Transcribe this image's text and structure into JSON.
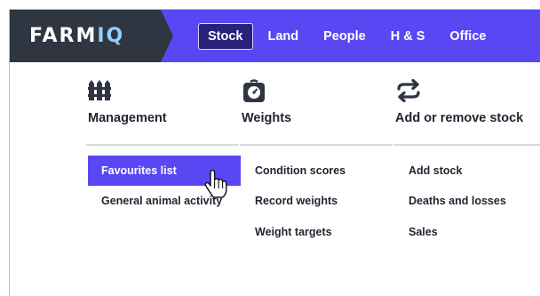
{
  "brand": {
    "logo_main": "FARM",
    "logo_accent": "IQ"
  },
  "nav": {
    "items": [
      {
        "label": "Stock",
        "active": true
      },
      {
        "label": "Land",
        "active": false
      },
      {
        "label": "People",
        "active": false
      },
      {
        "label": "H & S",
        "active": false
      },
      {
        "label": "Office",
        "active": false
      }
    ]
  },
  "menu": {
    "columns": [
      {
        "heading": "Management",
        "icon": "fence-icon",
        "links": [
          "Favourites list",
          "General animal activity"
        ],
        "selected_index": 0
      },
      {
        "heading": "Weights",
        "icon": "scale-icon",
        "links": [
          "Condition scores",
          "Record weights",
          "Weight targets"
        ]
      },
      {
        "heading": "Add or remove stock",
        "icon": "swap-arrows-icon",
        "links": [
          "Add stock",
          "Deaths and losses",
          "Sales"
        ]
      }
    ]
  },
  "colors": {
    "accent": "#5a47f4",
    "logo_bg": "#2f3541",
    "active_tab": "#29207a",
    "text": "#1f2430"
  }
}
